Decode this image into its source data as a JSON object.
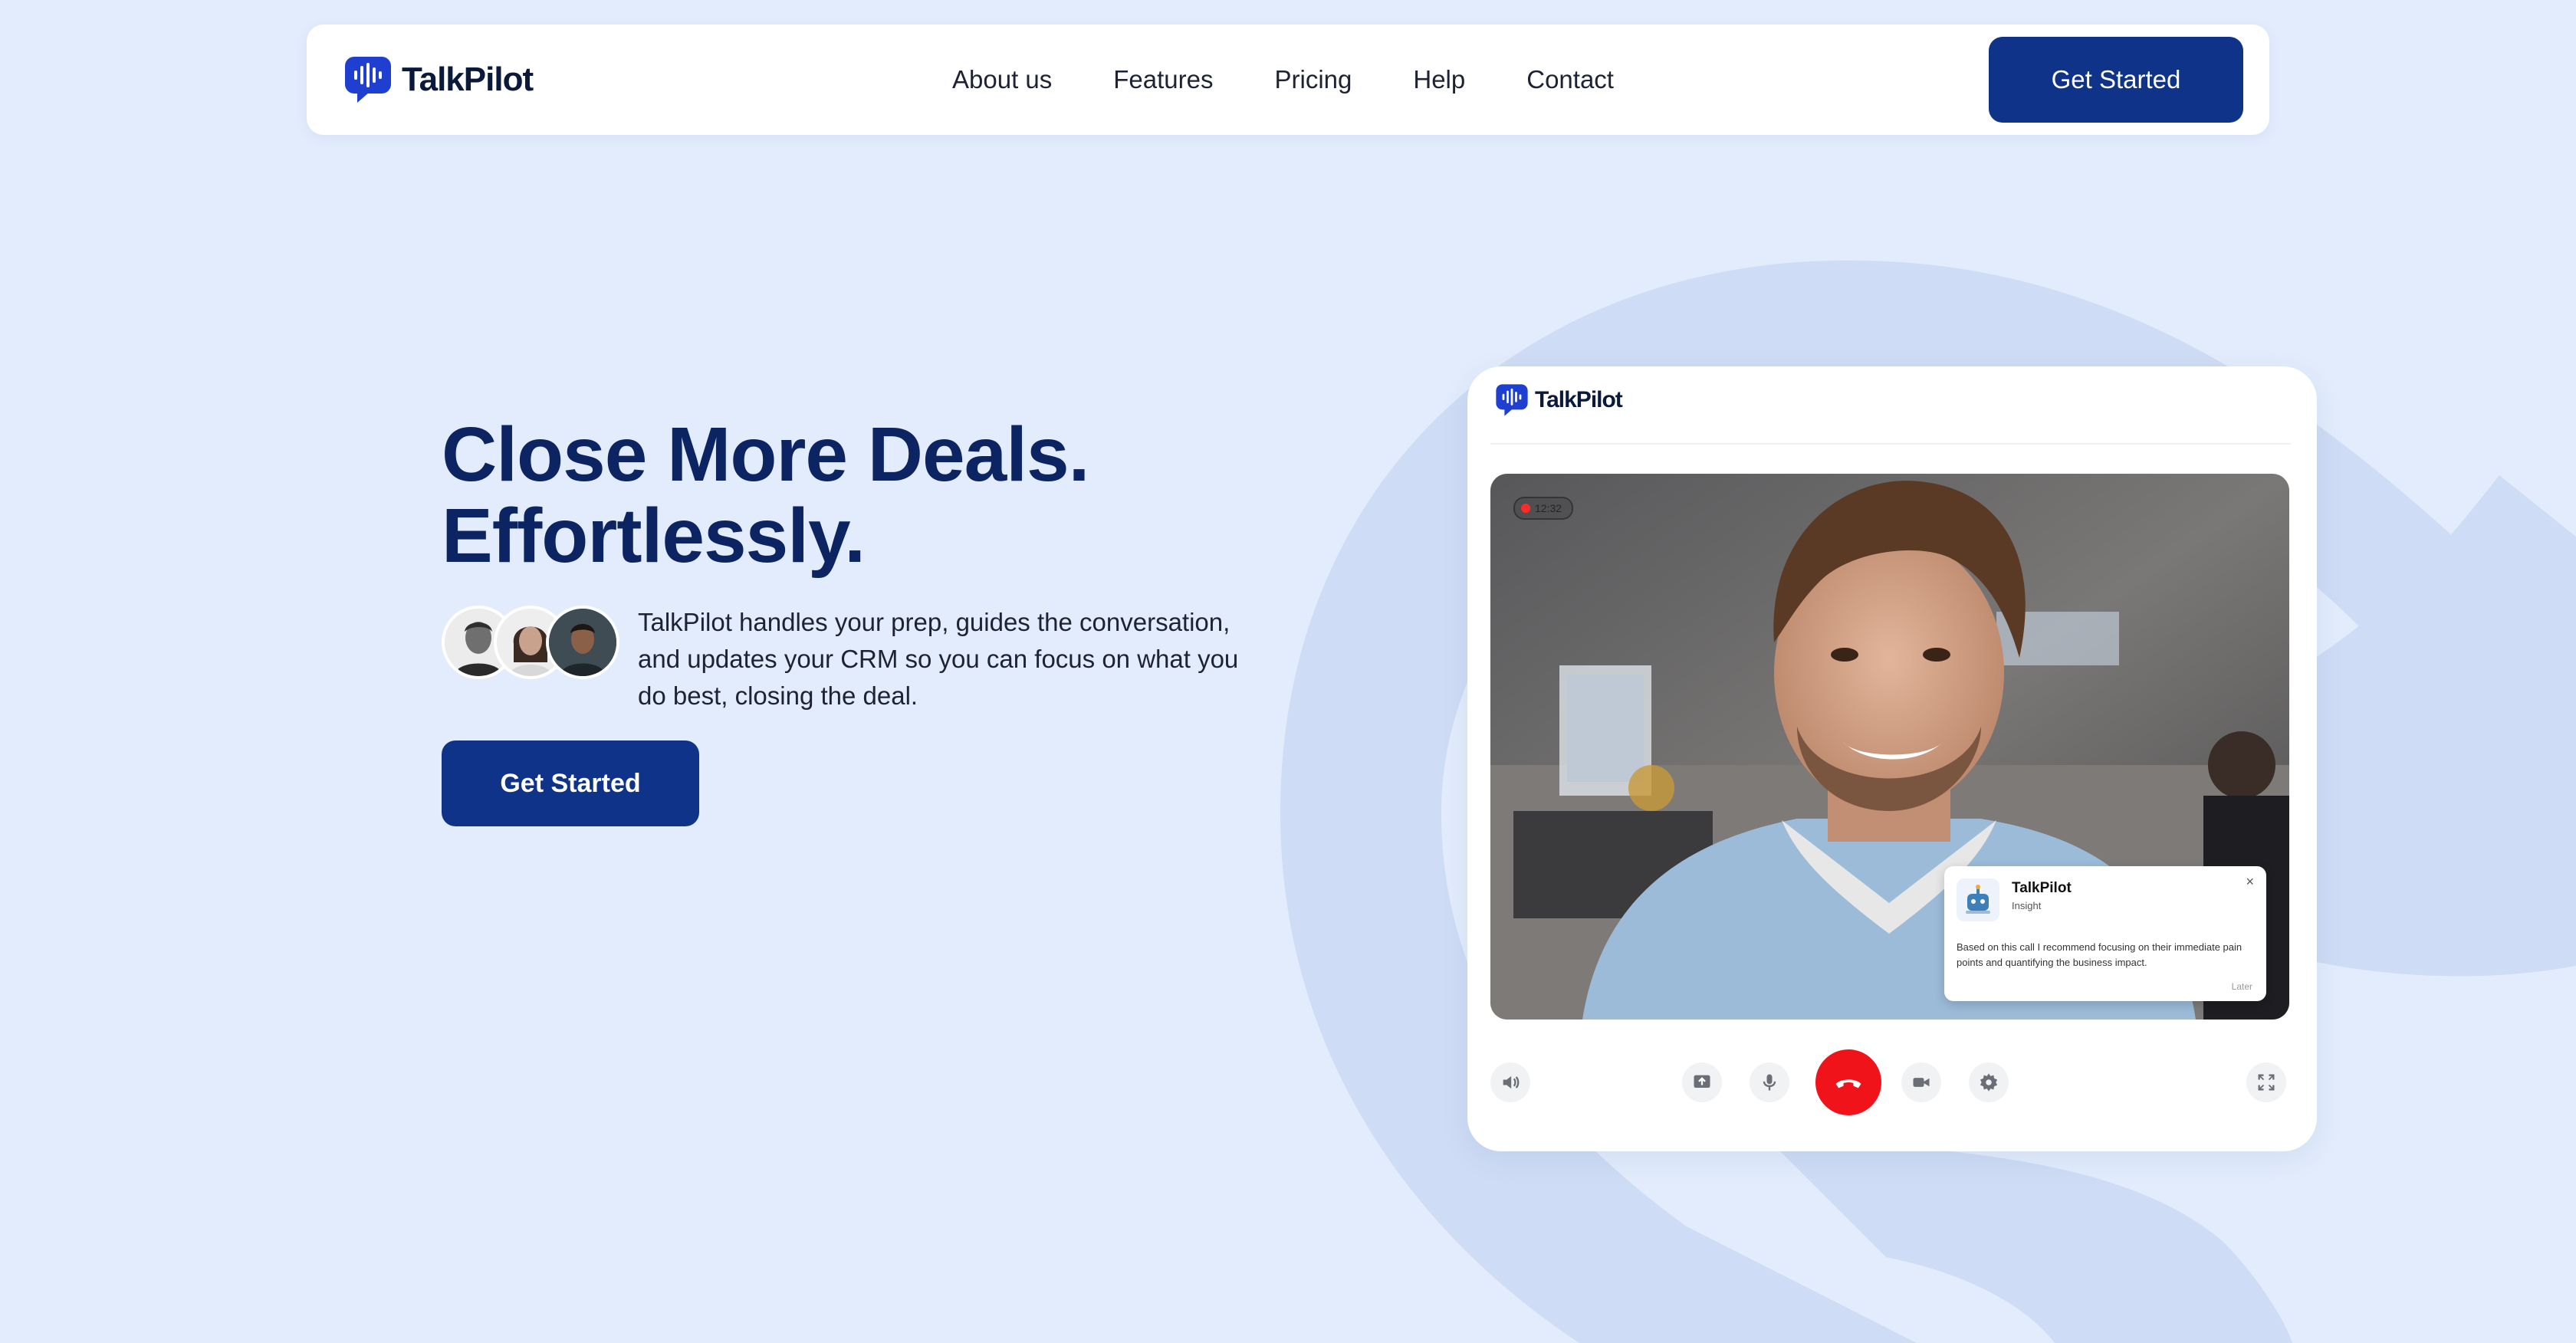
{
  "brand": {
    "name": "TalkPilot",
    "color": "#1f3fd0"
  },
  "nav": {
    "links": [
      "About us",
      "Features",
      "Pricing",
      "Help",
      "Contact"
    ],
    "cta_label": "Get Started"
  },
  "hero": {
    "title_line1": "Close More Deals.",
    "title_line2": "Effortlessly.",
    "description": "TalkPilot handles your prep, guides the conversation, and updates your CRM so you can focus on what you do best, closing the deal.",
    "cta_label": "Get Started"
  },
  "mockup": {
    "brand_name": "TalkPilot",
    "recording_time": "12:32",
    "insight": {
      "title": "TalkPilot",
      "subtitle": "Insight",
      "body": "Based on this call I recommend focusing on their immediate pain points and quantifying the business impact.",
      "dismiss_label": "Later",
      "close_icon": "×"
    },
    "controls": [
      "volume-icon",
      "share-screen-icon",
      "microphone-icon",
      "end-call-icon",
      "camera-icon",
      "settings-icon",
      "fullscreen-icon"
    ]
  },
  "colors": {
    "background": "#e2ecfc",
    "accent": "#0f3389",
    "heading": "#0c2461",
    "end_call": "#f0141a"
  }
}
